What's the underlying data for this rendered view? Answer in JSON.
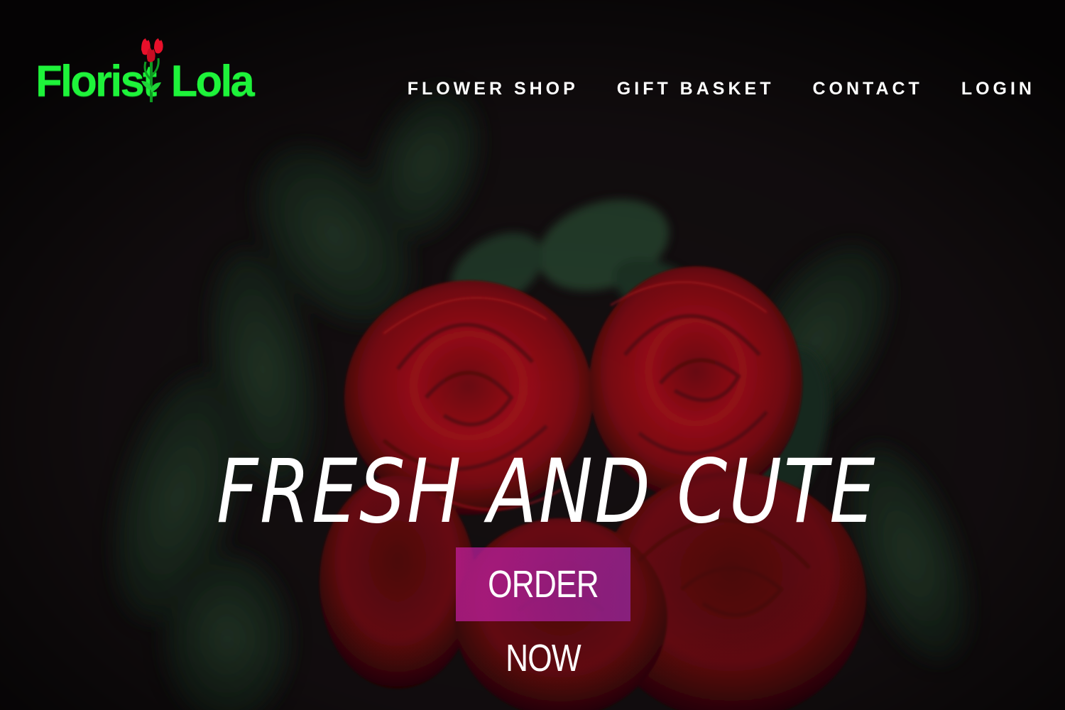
{
  "brand": {
    "name_part1": "Florist",
    "name_part2": "Lola",
    "color": "#1ef33a",
    "flower_color": "#e8102a"
  },
  "nav": {
    "items": [
      {
        "label": "FLOWER SHOP"
      },
      {
        "label": "GIFT BASKET"
      },
      {
        "label": "CONTACT"
      },
      {
        "label": "LOGIN"
      }
    ]
  },
  "hero": {
    "headline": "FRESH  AND  CUTE",
    "cta_label": "ORDER NOW",
    "cta_color": "#b12aa6",
    "background_subject": "red-roses-photo"
  }
}
